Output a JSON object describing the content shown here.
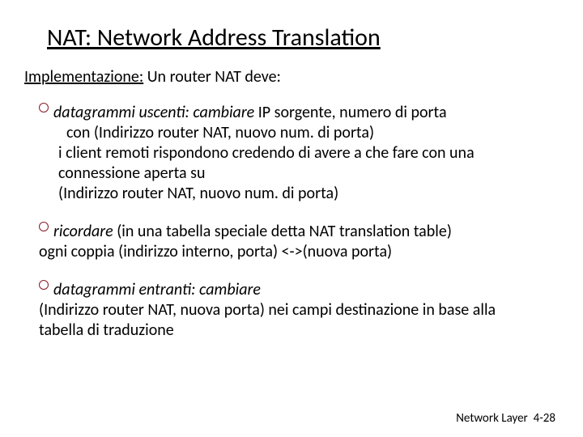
{
  "title": "NAT: Network Address Translation",
  "sub_u": "Implementazione:",
  "sub_rest": " Un router NAT deve:",
  "b1": {
    "lead_it": "datagrammi uscenti: cambiare",
    "lead_rest": " IP sorgente, numero di porta",
    "l2": "con (Indirizzo router NAT, nuovo num. di porta)",
    "l3": "i client remoti rispondono credendo di avere a che fare con una connessione aperta su",
    "l4": "(Indirizzo router NAT, nuovo num. di porta)"
  },
  "b2": {
    "lead_it": "ricordare",
    "lead_rest": " (in una tabella speciale detta NAT translation table)",
    "l2": "ogni coppia (indirizzo interno, porta) <->(nuova porta)"
  },
  "b3": {
    "lead_it": "datagrammi entranti: cambiare",
    "l2": "(Indirizzo router NAT, nuova porta) nei campi destinazione in base alla tabella di traduzione"
  },
  "footer_label": "Network Layer",
  "footer_page": "4-28"
}
